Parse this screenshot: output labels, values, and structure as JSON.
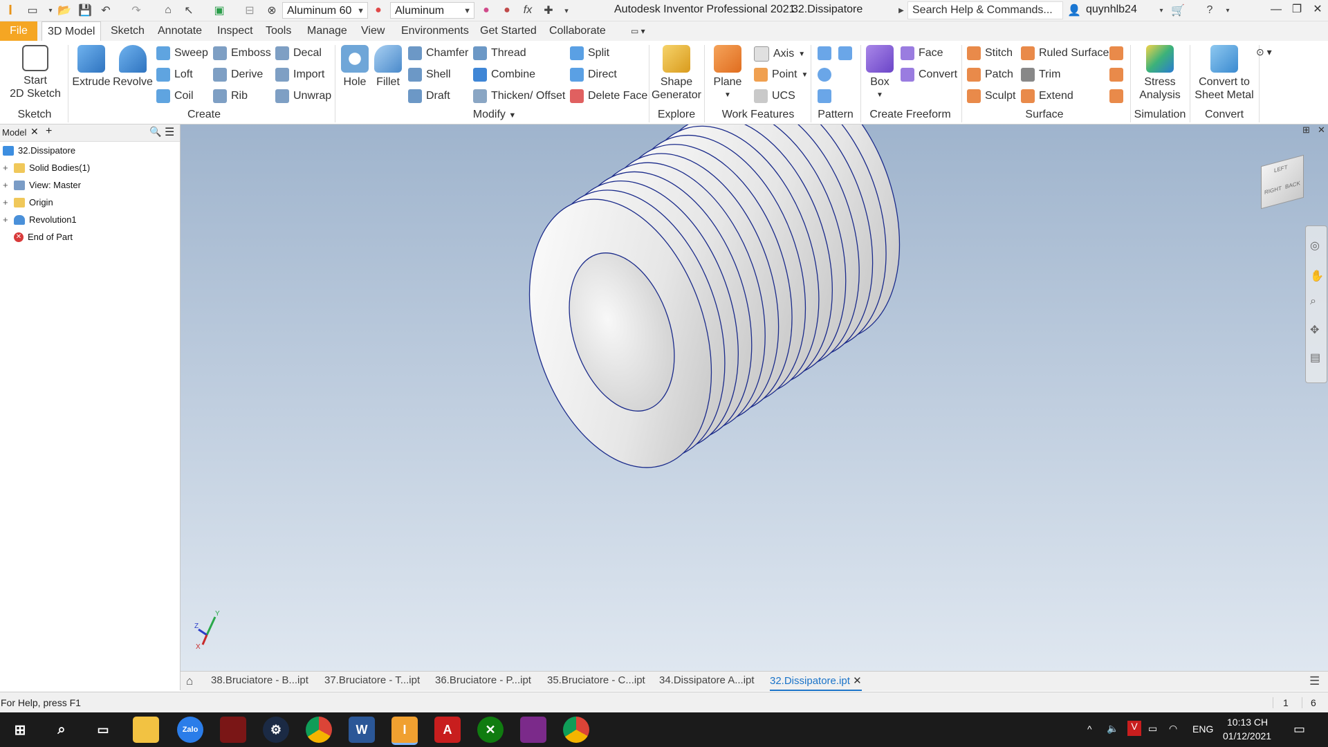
{
  "titlebar": {
    "material": "Aluminum 60",
    "appearance": "Aluminum",
    "app_title": "Autodesk Inventor Professional 2021",
    "doc_title": "32.Dissipatore",
    "search_placeholder": "Search Help & Commands...",
    "user": "quynhlb24",
    "fx": "fx"
  },
  "tabs": [
    "File",
    "3D Model",
    "Sketch",
    "Annotate",
    "Inspect",
    "Tools",
    "Manage",
    "View",
    "Environments",
    "Get Started",
    "Collaborate"
  ],
  "ribbon": {
    "sketch": {
      "start": "Start",
      "start2": "2D Sketch",
      "label": "Sketch"
    },
    "create": {
      "extrude": "Extrude",
      "revolve": "Revolve",
      "sweep": "Sweep",
      "loft": "Loft",
      "coil": "Coil",
      "emboss": "Emboss",
      "derive": "Derive",
      "rib": "Rib",
      "decal": "Decal",
      "import": "Import",
      "unwrap": "Unwrap",
      "label": "Create"
    },
    "modify": {
      "hole": "Hole",
      "fillet": "Fillet",
      "chamfer": "Chamfer",
      "shell": "Shell",
      "draft": "Draft",
      "thread": "Thread",
      "combine": "Combine",
      "thicken": "Thicken/ Offset",
      "split": "Split",
      "direct": "Direct",
      "delete_face": "Delete Face",
      "label": "Modify"
    },
    "explore": {
      "shape": "Shape",
      "generator": "Generator",
      "label": "Explore"
    },
    "work": {
      "plane": "Plane",
      "axis": "Axis",
      "point": "Point",
      "ucs": "UCS",
      "label": "Work Features"
    },
    "pattern": {
      "label": "Pattern"
    },
    "freeform": {
      "box": "Box",
      "face": "Face",
      "convert": "Convert",
      "label": "Create Freeform"
    },
    "surface": {
      "stitch": "Stitch",
      "patch": "Patch",
      "sculpt": "Sculpt",
      "ruled": "Ruled Surface",
      "trim": "Trim",
      "extend": "Extend",
      "label": "Surface"
    },
    "simulation": {
      "stress": "Stress",
      "analysis": "Analysis",
      "label": "Simulation"
    },
    "convert": {
      "c1": "Convert to",
      "c2": "Sheet Metal",
      "label": "Convert"
    }
  },
  "browser": {
    "tab": "Model",
    "items": [
      {
        "label": "32.Dissipatore"
      },
      {
        "label": "Solid Bodies(1)"
      },
      {
        "label": "View: Master"
      },
      {
        "label": "Origin"
      },
      {
        "label": "Revolution1"
      },
      {
        "label": "End of Part"
      }
    ]
  },
  "viewcube": {
    "top": "LEFT",
    "right": "BACK",
    "left": "RIGHT"
  },
  "triad": {
    "x": "X",
    "y": "Y",
    "z": "Z"
  },
  "doctabs": [
    "38.Bruciatore - B...ipt",
    "37.Bruciatore - T...ipt",
    "36.Bruciatore - P...ipt",
    "35.Bruciatore - C...ipt",
    "34.Dissipatore A...ipt",
    "32.Dissipatore.ipt"
  ],
  "status": {
    "help": "For Help, press F1",
    "n1": "1",
    "n2": "6"
  },
  "taskbar": {
    "zalo": "Zalo",
    "time": "10:13 CH",
    "date": "01/12/2021",
    "lang": "ENG"
  }
}
